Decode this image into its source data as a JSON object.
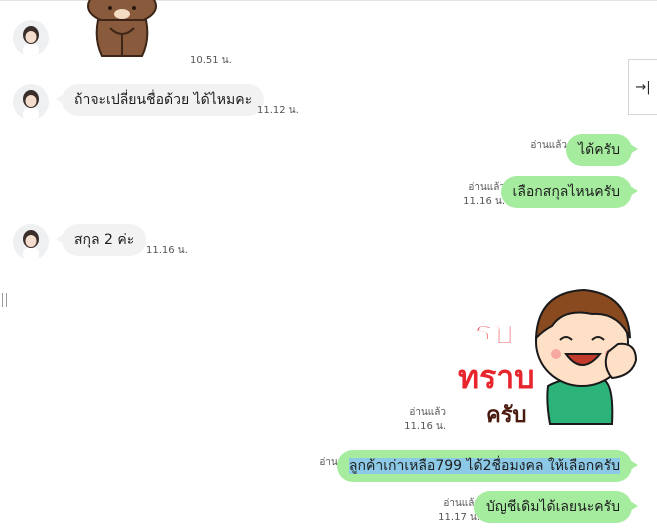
{
  "messages": [
    {
      "id": "m1",
      "dir": "in",
      "kind": "sticker",
      "sticker": "brown-bear-sticker",
      "time": "10.51 น."
    },
    {
      "id": "m2",
      "dir": "in",
      "kind": "text",
      "text": "ถ้าจะเปลี่ยนชื่อด้วย ได้ไหมคะ",
      "time": "11.12 น."
    },
    {
      "id": "m3",
      "dir": "out",
      "kind": "text",
      "text": "ได้ครับ",
      "read": "อ่านแล้ว",
      "time": ""
    },
    {
      "id": "m4",
      "dir": "out",
      "kind": "text",
      "text": "เลือกสกุลไหนครับ",
      "read": "อ่านแล้ว",
      "time": "11.16 น."
    },
    {
      "id": "m5",
      "dir": "in",
      "kind": "text",
      "text": "สกุล 2 ค่ะ",
      "time": "11.16 น."
    },
    {
      "id": "m6",
      "dir": "out",
      "kind": "sticker",
      "sticker": "boy-salute-sticker",
      "sticker_text": [
        "รับ",
        "ทราบ",
        "ครับ"
      ],
      "read": "อ่านแล้ว",
      "time": "11.16 น."
    },
    {
      "id": "m7",
      "dir": "out",
      "kind": "text",
      "text": "ลูกค้าเก่าเหลือ799 ได้2ชื่อมงคล ให้เลือกครับ",
      "read": "อ่านแล้ว",
      "time": "",
      "highlighted": true
    },
    {
      "id": "m8",
      "dir": "out",
      "kind": "text",
      "text": "บัญชีเดิมได้เลยนะครับ",
      "read": "อ่านแล้ว",
      "time": "11.17 น."
    }
  ],
  "side_panel_button": {
    "icon": "collapse-right-arrow-icon",
    "glyph": "→|"
  },
  "colors": {
    "outgoing": "#a5ec9f",
    "incoming": "#f2f2f2",
    "highlight": "#8bc9e6",
    "sticker_red": "#e8252c"
  }
}
